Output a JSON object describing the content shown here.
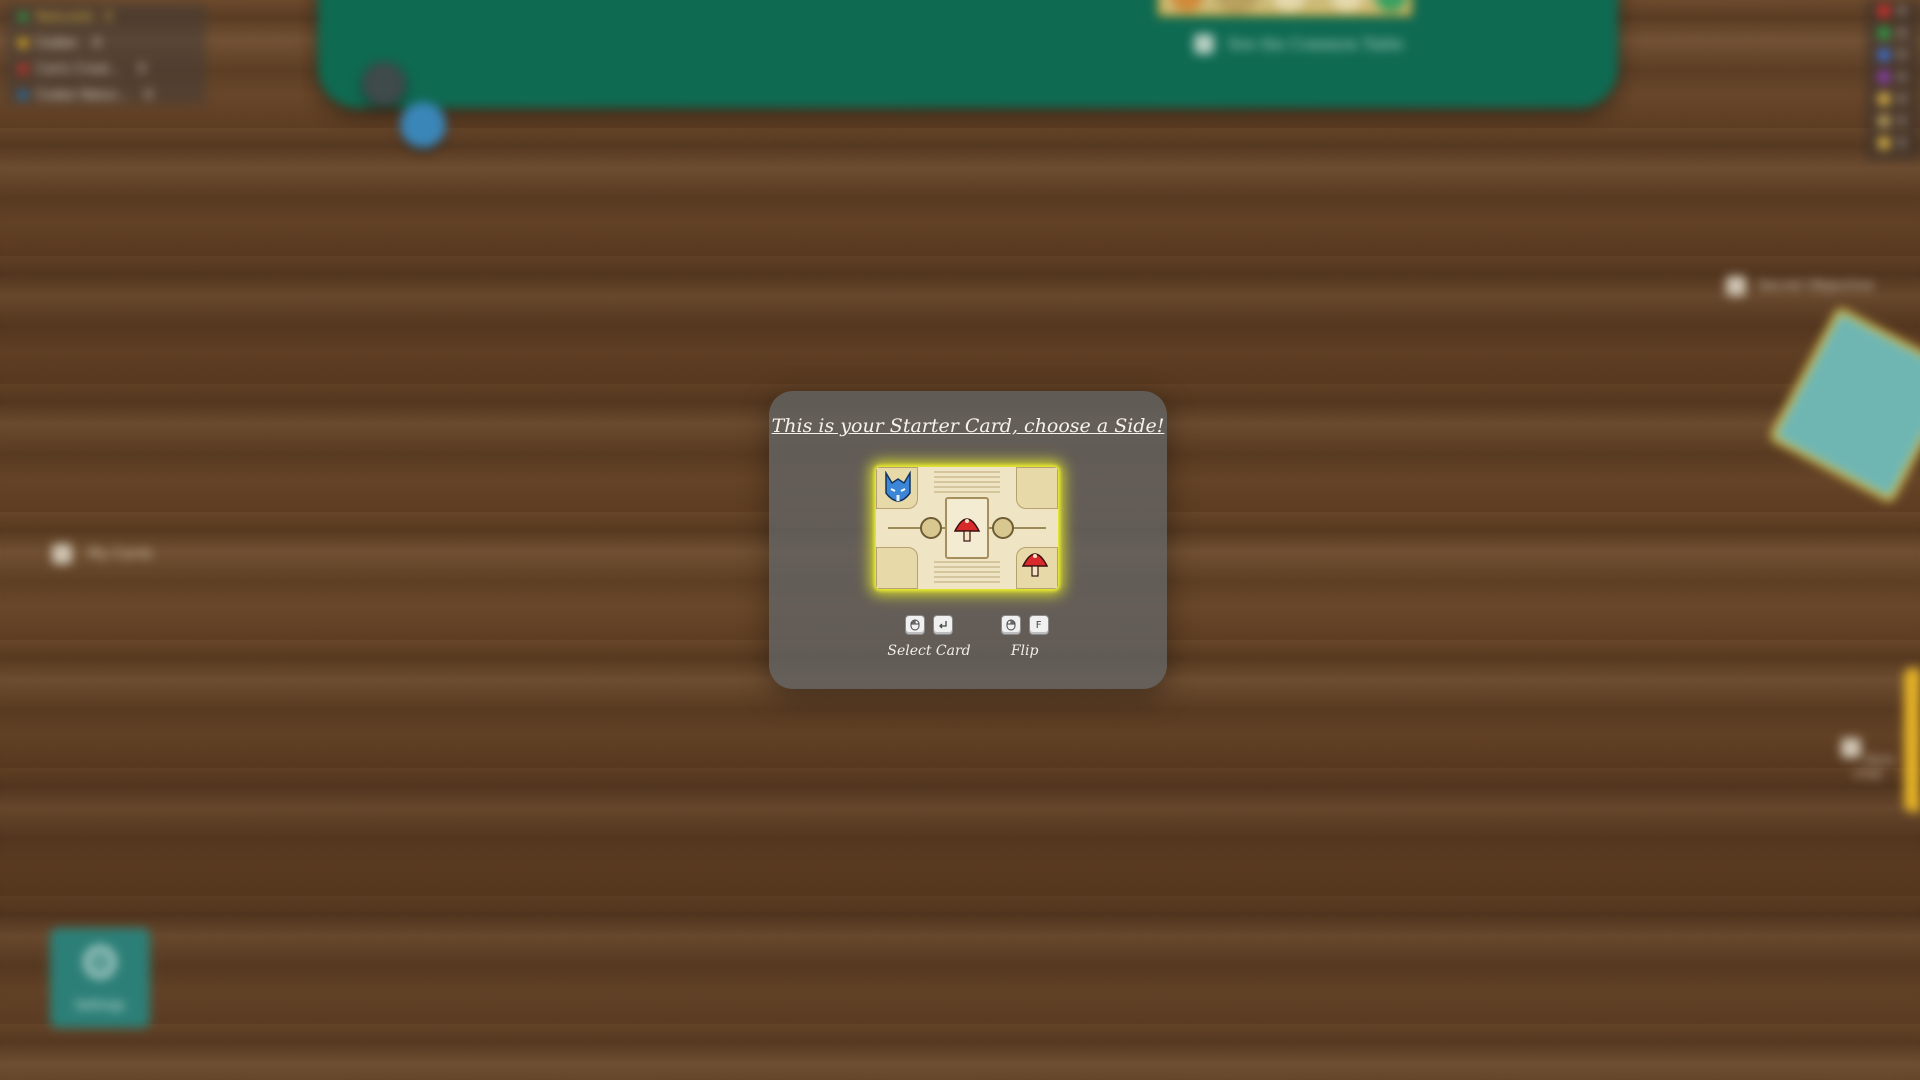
{
  "players": [
    {
      "name": "Naturalis",
      "score": "0",
      "color": "#2e9b48",
      "highlight": "#e2c14c"
    },
    {
      "name": "Codex",
      "score": "0",
      "color": "#e2b320",
      "highlight": "#e8e0d0"
    },
    {
      "name": "Carlo Creat...",
      "score": "0",
      "color": "#d2312b",
      "highlight": "#e8e0d0"
    },
    {
      "name": "Codex Natur...",
      "score": "0",
      "color": "#1d6fb0",
      "highlight": "#e8e0d0"
    }
  ],
  "common_table": {
    "see_label": "See the Common Table"
  },
  "resources": [
    {
      "icon": "red-resource-icon",
      "value": "0",
      "color": "#d0312d"
    },
    {
      "icon": "green-resource-icon",
      "value": "0",
      "color": "#2e9b48"
    },
    {
      "icon": "blue-resource-icon",
      "value": "0",
      "color": "#3d6fd1"
    },
    {
      "icon": "purple-resource-icon",
      "value": "0",
      "color": "#8a3fb0"
    },
    {
      "icon": "quill-icon",
      "value": "0",
      "color": "#d7b24a"
    },
    {
      "icon": "inkwell-icon",
      "value": "0",
      "color": "#b6a05e"
    },
    {
      "icon": "manuscript-icon",
      "value": "0",
      "color": "#d7b24a"
    }
  ],
  "secret_objective_label": "Secret Objective",
  "my_cards_label": "My Cards",
  "more_chat_label": "More Chat",
  "settings_label": "Settings",
  "modal": {
    "title": "This is your Starter Card, choose a Side!",
    "hints": [
      {
        "keys": [
          "mouse-left-icon",
          "enter-key-icon"
        ],
        "label": "Select Card"
      },
      {
        "keys": [
          "mouse-right-icon",
          "F"
        ],
        "label": "Flip"
      }
    ]
  },
  "colors": {
    "table_felt": "#0f6a52",
    "card_glow": "#e8ec28",
    "modal_bg": "rgba(100,100,100,0.8)"
  }
}
